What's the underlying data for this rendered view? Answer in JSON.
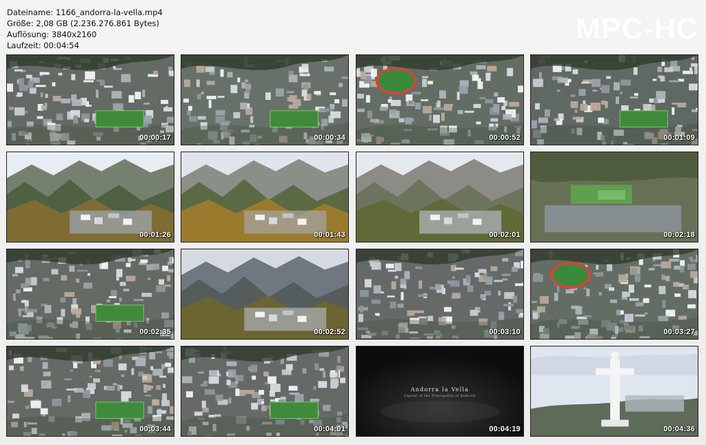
{
  "header": {
    "filename_line": "Dateiname: 1166_andorra-la-vella.mp4",
    "size_line": "Größe: 2,08 GB (2.236.276.861 Bytes)",
    "resolution_line": "Auflösung: 3840x2160",
    "duration_line": "Laufzeit: 00:04:54"
  },
  "brand": "MPC-HC",
  "thumbnails": [
    {
      "time": "00:00:17",
      "scene": "aerial-town-stadium"
    },
    {
      "time": "00:00:34",
      "scene": "aerial-buildings-field"
    },
    {
      "time": "00:00:52",
      "scene": "aerial-town-track"
    },
    {
      "time": "00:01:09",
      "scene": "aerial-valley-town"
    },
    {
      "time": "00:01:26",
      "scene": "mountain-valley-town"
    },
    {
      "time": "00:01:43",
      "scene": "mountain-autumn-village"
    },
    {
      "time": "00:02:01",
      "scene": "rocky-mountain-town"
    },
    {
      "time": "00:02:18",
      "scene": "valley-fields"
    },
    {
      "time": "00:02:35",
      "scene": "aerial-town-stadium"
    },
    {
      "time": "00:02:52",
      "scene": "mountain-valley-haze"
    },
    {
      "time": "00:03:10",
      "scene": "aerial-buildings-close"
    },
    {
      "time": "00:03:27",
      "scene": "aerial-town-track"
    },
    {
      "time": "00:03:44",
      "scene": "aerial-town-stadium"
    },
    {
      "time": "00:04:01",
      "scene": "aerial-old-town"
    },
    {
      "time": "00:04:19",
      "scene": "title-card",
      "title": "Andorra la Vella",
      "subtitle": "Capital of the Principality of Andorra"
    },
    {
      "time": "00:04:36",
      "scene": "statue-sky"
    }
  ],
  "colors": {
    "page_background": "#efefef",
    "text": "#111111",
    "brand": "#ffffff",
    "timestamp": "#ffffff"
  }
}
